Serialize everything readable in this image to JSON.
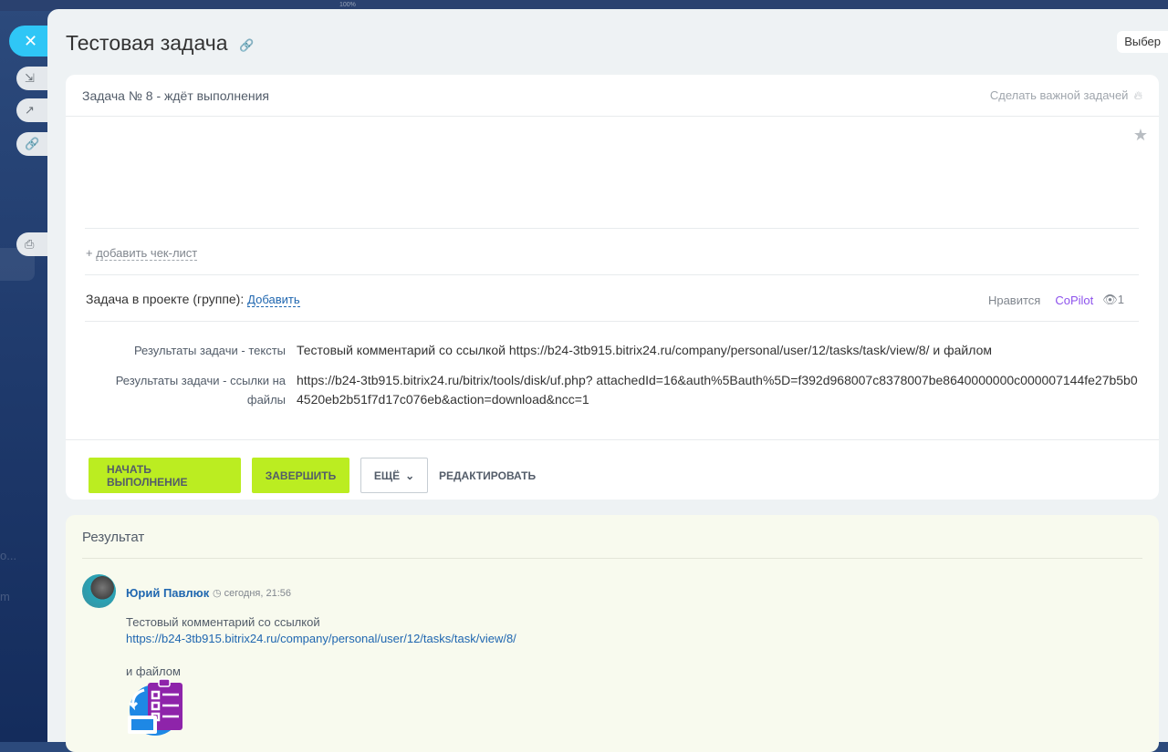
{
  "background": {
    "zoom_label": "100%",
    "faint_text_1": "о...",
    "faint_text_2": "m"
  },
  "panel": {
    "title": "Тестовая задача",
    "choose_label": "Выбер",
    "task": {
      "status": "Задача № 8 - ждёт выполнения",
      "make_important": "Сделать важной задачей",
      "add_checklist": "добавить чек-лист",
      "add_checklist_plus": "+",
      "project_label": "Задача в проекте (группе):",
      "project_add": "Добавить",
      "like": "Нравится",
      "copilot": "CoPilot",
      "views": "1",
      "fields": [
        {
          "label": "Результаты задачи - тексты",
          "value": "Тестовый комментарий со ссылкой https://b24-3tb915.bitrix24.ru/company/personal/user/12/tasks/task/view/8/ и файлом"
        },
        {
          "label": "Результаты задачи - ссылки на файлы",
          "value": "https://b24-3tb915.bitrix24.ru/bitrix/tools/disk/uf.php? attachedId=16&auth%5Bauth%5D=f392d968007c8378007be8640000000c000007144fe27b5b04520eb2b51f7d17c076eb&action=download&ncc=1"
        }
      ],
      "buttons": {
        "start": "НАЧАТЬ ВЫПОЛНЕНИЕ",
        "finish": "ЗАВЕРШИТЬ",
        "more": "ЕЩЁ",
        "edit": "РЕДАКТИРОВАТЬ"
      }
    },
    "result": {
      "title": "Результат",
      "author": "Юрий Павлюк",
      "time": "сегодня, 21:56",
      "text_1": "Тестовый комментарий со ссылкой",
      "link": "https://b24-3tb915.bitrix24.ru/company/personal/user/12/tasks/task/view/8/",
      "text_2": "и файлом"
    }
  },
  "colors": {
    "accent_green": "#bbed21",
    "link_blue": "#2067b0",
    "close_blue": "#2fc6f6",
    "copilot_purple": "#8d52ec"
  }
}
